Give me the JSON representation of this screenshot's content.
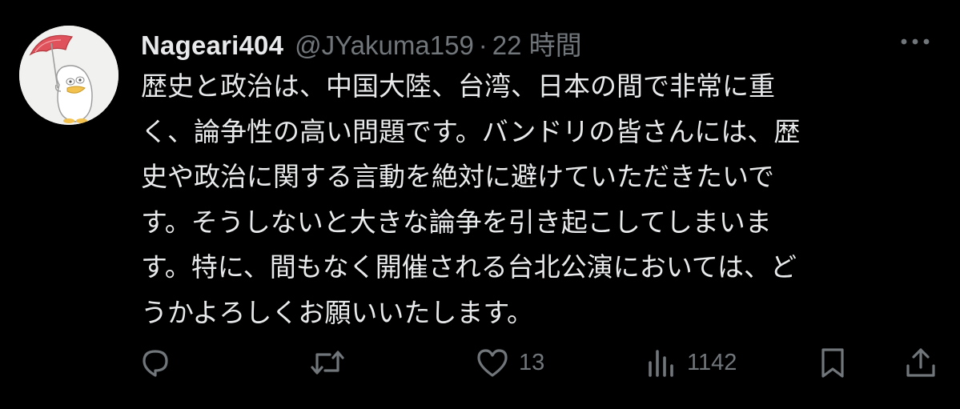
{
  "tweet": {
    "display_name": "Nageari404",
    "handle": "@JYakuma159",
    "separator": "·",
    "timestamp": "22 時間",
    "lines": [
      "歴史と政治は、中国大陸、台湾、日本の間で非常に重",
      "く、論争性の高い問題です。バンドリの皆さんには、歴",
      "史や政治に関する言動を絶対に避けていただきたいで",
      "す。そうしないと大きな論争を引き起こしてしまいま",
      "す。特に、間もなく開催される台北公演においては、ど",
      "うかよろしくお願いいたします。"
    ]
  },
  "actions": {
    "reply_count": "",
    "retweet_count": "",
    "like_count": "13",
    "view_count": "1142"
  },
  "icons": {
    "more": "more-icon",
    "reply": "reply-icon",
    "retweet": "retweet-icon",
    "like": "heart-icon",
    "views": "views-icon",
    "bookmark": "bookmark-icon",
    "share": "share-icon"
  },
  "colors": {
    "background": "#000000",
    "text_primary": "#e7e9ea",
    "text_secondary": "#71767b",
    "umbrella": "#e0525b"
  }
}
